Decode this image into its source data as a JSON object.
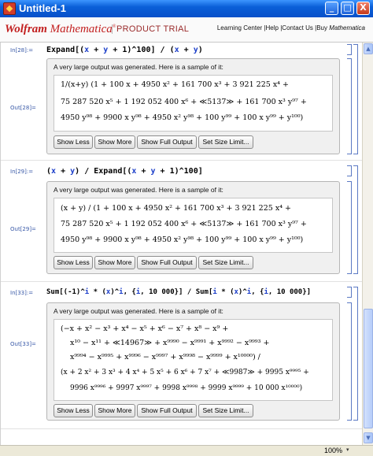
{
  "window": {
    "title": "Untitled-1",
    "minimize": "_",
    "maximize": "□",
    "close": "X"
  },
  "header": {
    "logo_brand": "Wolfram",
    "logo_product": "Mathematica",
    "logo_mark": "®",
    "trial_label": "PRODUCT TRIAL",
    "links": [
      "Learning Center",
      "Help",
      "Contact Us",
      "Buy "
    ],
    "links_buy_em": "Mathematica",
    "separator": " |"
  },
  "cells": [
    {
      "in_label": "In[28]:=",
      "out_label": "Out[28]=",
      "input_parts": [
        "Expand[(",
        "x",
        " + ",
        "y",
        " + 1)^100] / (",
        "x",
        " + ",
        "y",
        ")"
      ],
      "message": "A very large output was generated. Here is a sample of it:",
      "output_lines": [
        "1/(x+y) (1 + 100 x + 4950 x² + 161 700 x³ + 3 921 225 x⁴ +",
        "75 287 520 x⁵ + 1 192 052 400 x⁶ + ≪5137≫ + 161 700 x³ y⁹⁷ +",
        "4950 y⁹⁸ + 9900 x y⁹⁸ + 4950 x² y⁹⁸ + 100 y⁹⁹ + 100 x y⁹⁹ + y¹⁰⁰)"
      ]
    },
    {
      "in_label": "In[29]:=",
      "out_label": "Out[29]=",
      "input_parts": [
        "(",
        "x",
        " + ",
        "y",
        ") / Expand[(",
        "x",
        " + ",
        "y",
        " + 1)^100]"
      ],
      "message": "A very large output was generated. Here is a sample of it:",
      "output_lines": [
        "(x + y) / (1 + 100 x + 4950 x² + 161 700 x³ + 3 921 225 x⁴ +",
        "75 287 520 x⁵ + 1 192 052 400 x⁶ + ≪5137≫ + 161 700 x³ y⁹⁷ +",
        "4950 y⁹⁸ + 9900 x y⁹⁸ + 4950 x² y⁹⁸ + 100 y⁹⁹ + 100 x y⁹⁹ + y¹⁰⁰)"
      ]
    },
    {
      "in_label": "In[33]:=",
      "out_label": "Out[33]=",
      "input_parts": [
        "Sum[(-1)^",
        "i",
        " * (",
        "x",
        ")^",
        "i",
        ", {",
        "i",
        ", 10 000}] / Sum[",
        "i",
        " * (",
        "x",
        ")^",
        "i",
        ", {",
        "i",
        ", 10 000}]"
      ],
      "message": "A very large output was generated. Here is a sample of it:",
      "output_lines": [
        "(−x + x² − x³ + x⁴ − x⁵ + x⁶ − x⁷ + x⁸ − x⁹ +",
        "x¹⁰ − x¹¹ + ≪14967≫ + x⁹⁹⁹⁰ − x⁹⁹⁹¹ + x⁹⁹⁹² − x⁹⁹⁹³ +",
        "x⁹⁹⁹⁴ − x⁹⁹⁹⁵ + x⁹⁹⁹⁶ − x⁹⁹⁹⁷ + x⁹⁹⁹⁸ − x⁹⁹⁹⁹ + x¹⁰⁰⁰⁰) /",
        "(x + 2 x² + 3 x³ + 4 x⁴ + 5 x⁵ + 6 x⁶ + 7 x⁷ + ≪9987≫ + 9995 x⁹⁹⁹⁵ +",
        "9996 x⁹⁹⁹⁶ + 9997 x⁹⁹⁹⁷ + 9998 x⁹⁹⁹⁸ + 9999 x⁹⁹⁹⁹ + 10 000 x¹⁰⁰⁰⁰)"
      ]
    }
  ],
  "buttons": {
    "show_less": "Show Less",
    "show_more": "Show More",
    "show_full": "Show Full Output",
    "set_limit": "Set Size Limit..."
  },
  "status": {
    "zoom": "100%",
    "zoom_caret": "▾"
  },
  "scrollbar": {
    "up": "▲",
    "down": "▼"
  }
}
